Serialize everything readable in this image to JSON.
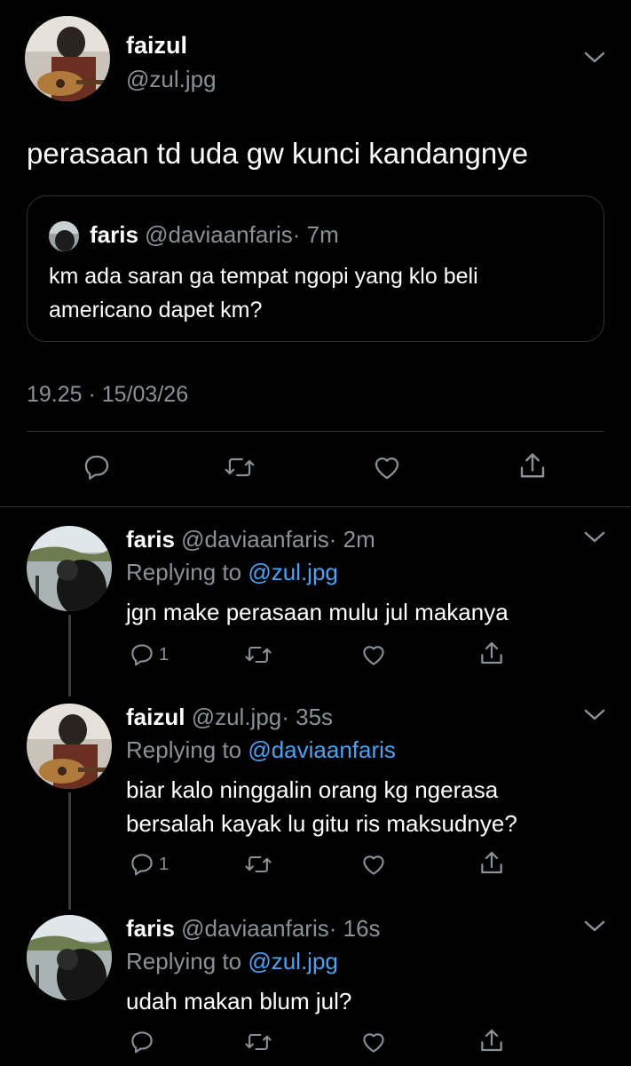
{
  "main_tweet": {
    "name": "faizul",
    "handle": "@zul.jpg",
    "text": "perasaan td uda gw kunci kandangnye",
    "timestamp": "19.25 · 15/03/26"
  },
  "quoted_tweet": {
    "name": "faris",
    "handle": "@daviaanfaris",
    "time": "· 7m",
    "text_line1": "km ada saran ga tempat ngopi yang klo beli",
    "text_line2": "americano dapet km?"
  },
  "replies": [
    {
      "name": "faris",
      "handle": "@daviaanfaris",
      "time": "· 2m",
      "replying_prefix": "Replying to",
      "replying_to": "@zul.jpg",
      "text_line1": "jgn make perasaan mulu jul makanya",
      "text_line2": "",
      "reply_count": "1"
    },
    {
      "name": "faizul",
      "handle": "@zul.jpg",
      "time": "· 35s",
      "replying_prefix": "Replying to",
      "replying_to": "@daviaanfaris",
      "text_line1": "biar kalo ninggalin orang kg ngerasa",
      "text_line2": "bersalah kayak lu gitu ris maksudnye?",
      "reply_count": "1"
    },
    {
      "name": "faris",
      "handle": "@daviaanfaris",
      "time": "· 16s",
      "replying_prefix": "Replying to",
      "replying_to": "@zul.jpg",
      "text_line1": "udah makan blum jul?",
      "text_line2": "",
      "reply_count": ""
    }
  ],
  "colors": {
    "background": "#000000",
    "text": "#ffffff",
    "muted": "#8a9197",
    "link": "#4ca3f2",
    "border": "#2f3336"
  },
  "icons": [
    "chevron-down-icon",
    "reply-icon",
    "retweet-icon",
    "like-icon",
    "share-icon"
  ]
}
